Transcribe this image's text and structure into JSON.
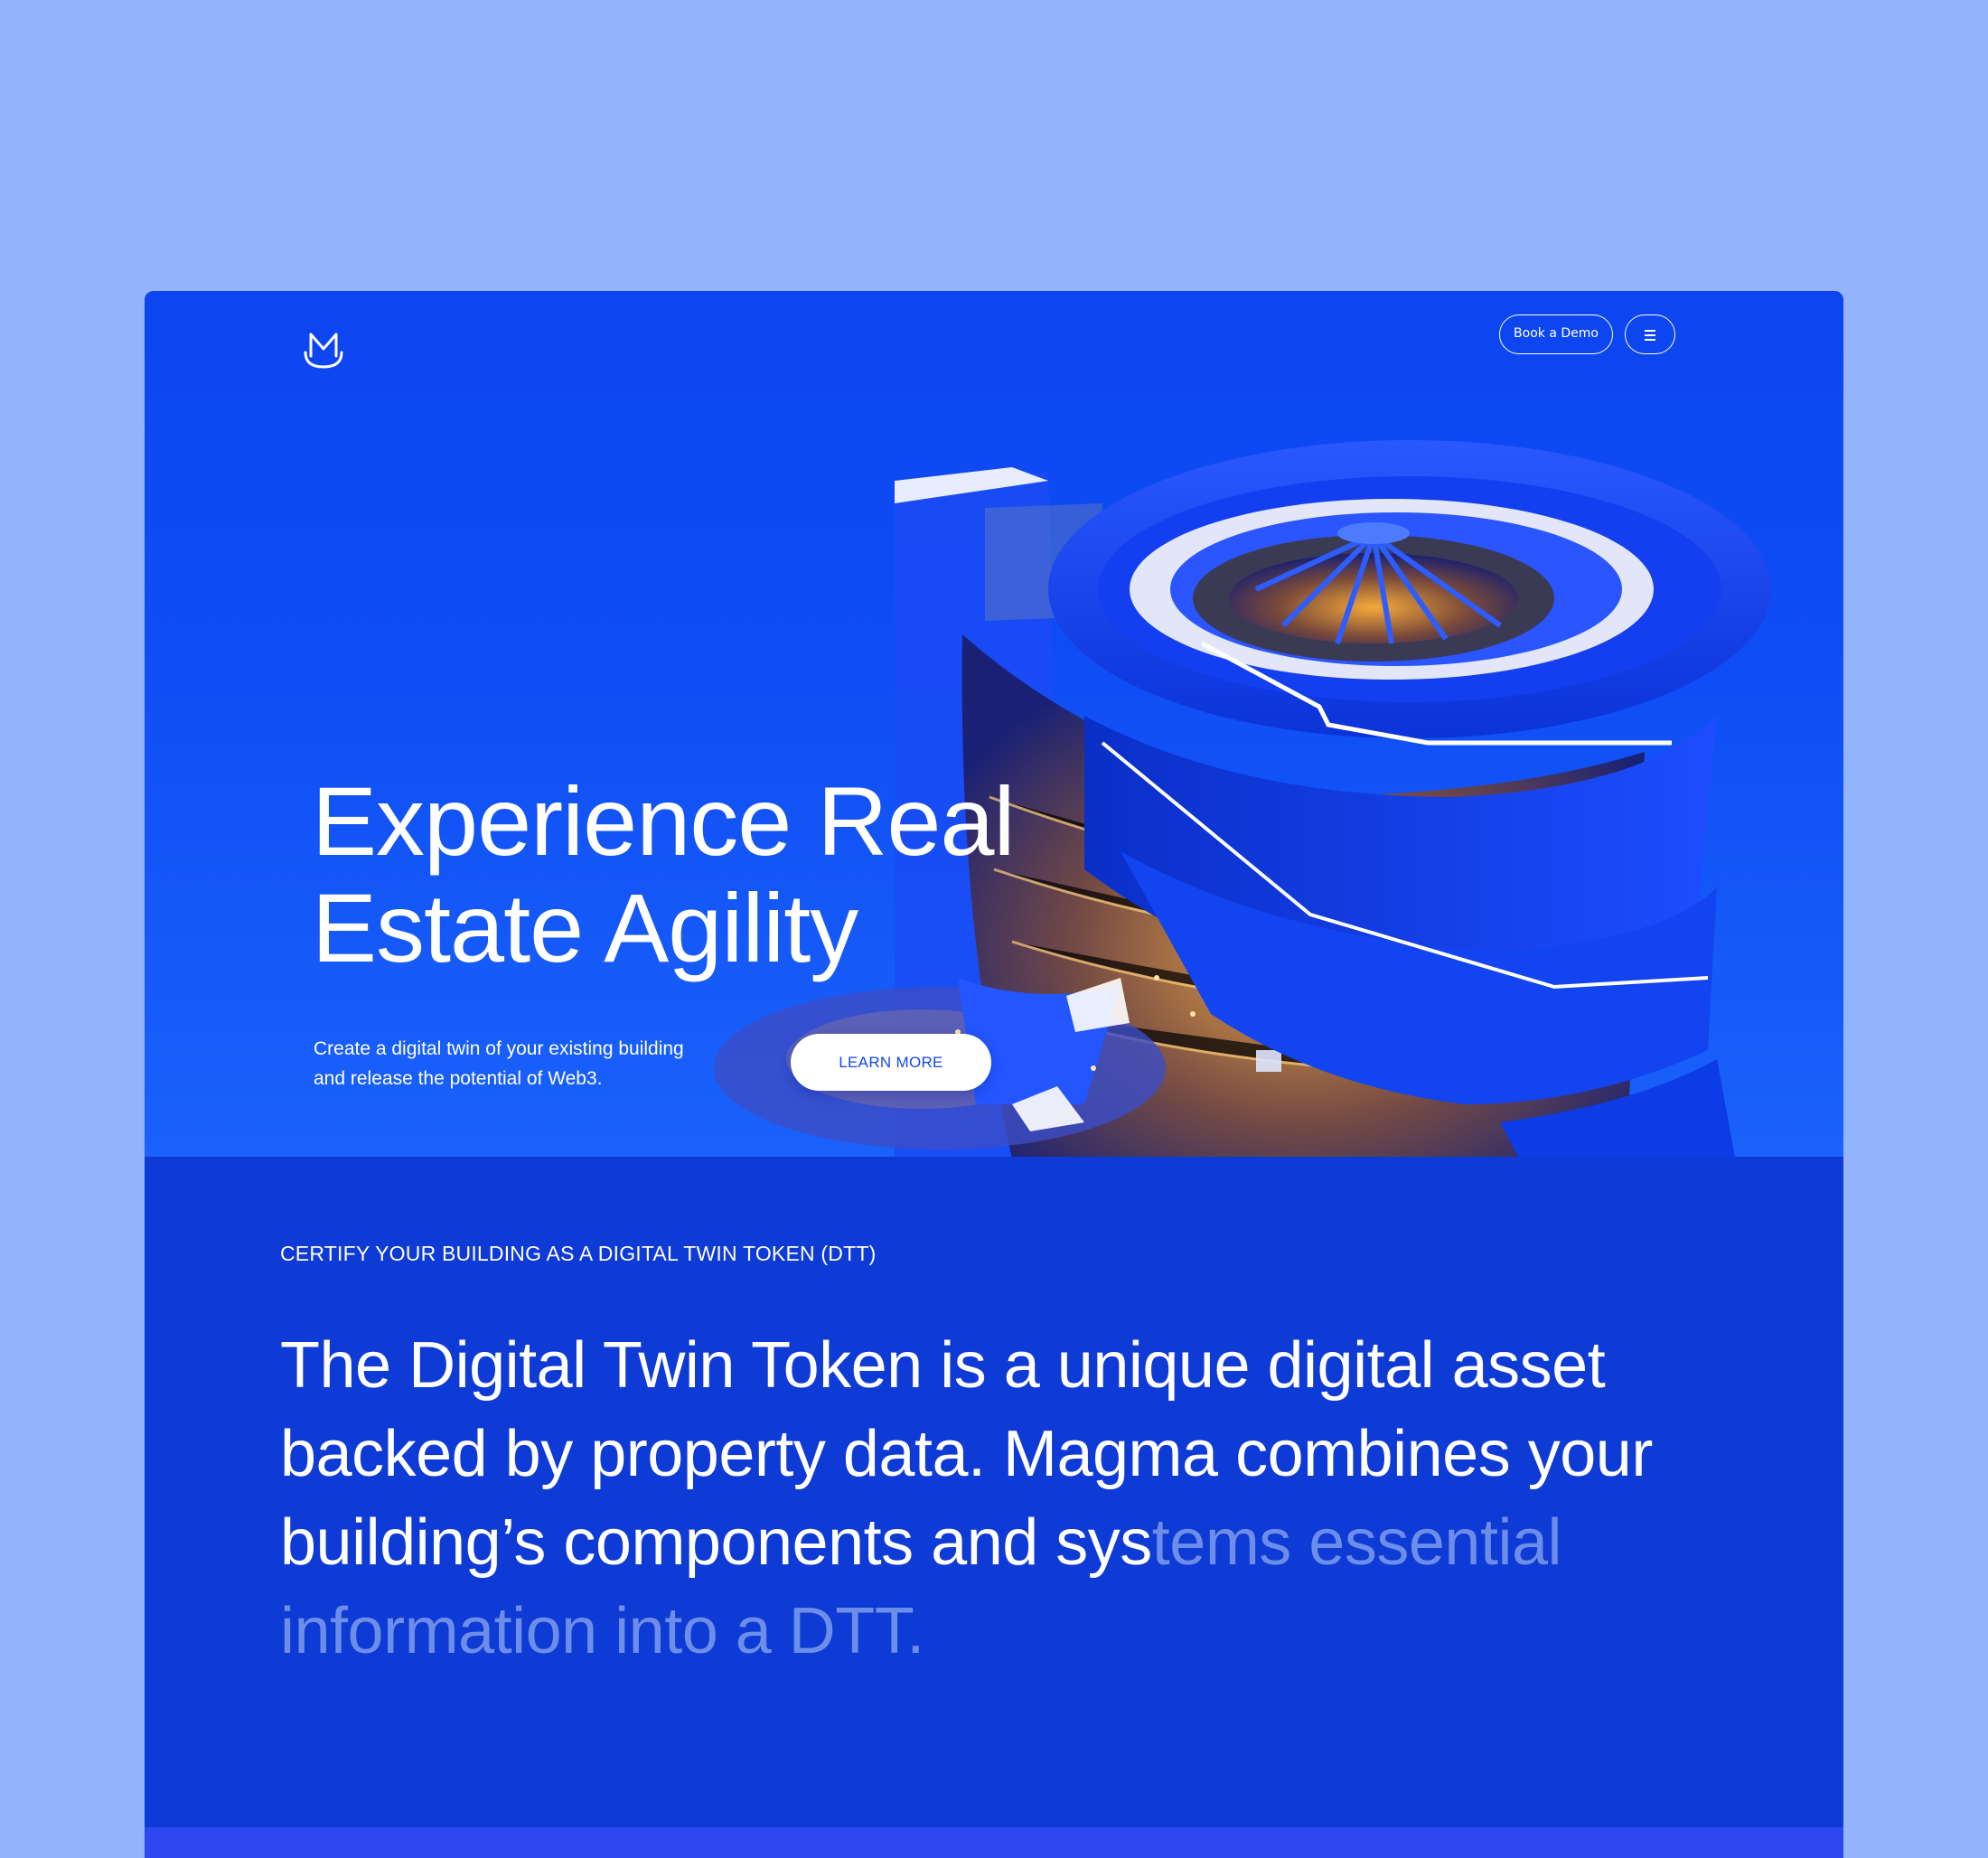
{
  "colors": {
    "page_background": "#93b4fd",
    "hero_blue": "#1250f5",
    "section_blue": "#0e3ad6",
    "band_blue": "#2e47f0",
    "faded_text": "#6d8ee8"
  },
  "header": {
    "logo_icon": "magma-m-logo-icon",
    "book_demo_label": "Book a Demo",
    "menu_icon": "hamburger-menu-icon"
  },
  "hero": {
    "title_line1": "Experience Real",
    "title_line2": "Estate Agility",
    "subtitle_line1": "Create a digital twin of your existing building",
    "subtitle_line2": "and release the potential of Web3.",
    "cta_label": "LEARN MORE",
    "illustration": "3d-cutaway-building-illustration"
  },
  "section": {
    "eyebrow": "CERTIFY YOUR BUILDING AS A DIGITAL TWIN TOKEN (DTT)",
    "statement_visible": "The Digital Twin Token is a unique digital asset backed by property data. Magma combines your building’s components and sys",
    "statement_faded": "tems essential information into a DTT."
  }
}
